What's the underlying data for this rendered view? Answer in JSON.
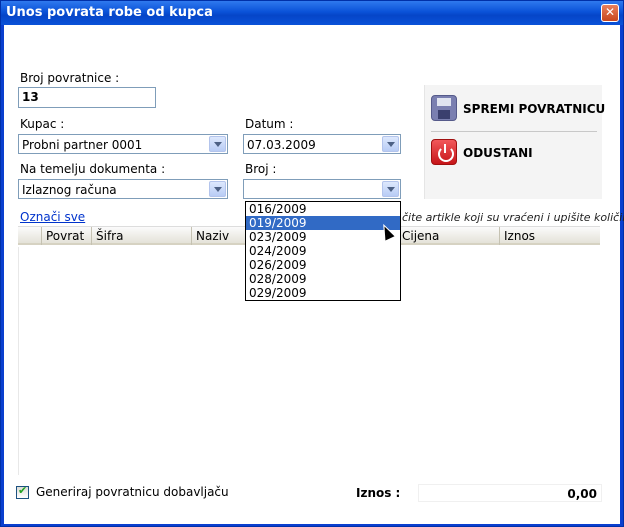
{
  "window": {
    "title": "Unos povrata robe od kupca",
    "close_glyph": "✕"
  },
  "form": {
    "broj_povratnice": {
      "label": "Broj povratnice :",
      "value": "13"
    },
    "kupac": {
      "label": "Kupac :",
      "value": "Probni partner 0001"
    },
    "datum": {
      "label": "Datum :",
      "value": "07.03.2009"
    },
    "na_temelju": {
      "label": "Na temelju dokumenta :",
      "value": "Izlaznog računa"
    },
    "broj": {
      "label": "Broj :",
      "value": ""
    }
  },
  "commands": {
    "save": {
      "label": "SPREMI POVRATNICU",
      "icon": "floppy-disk-icon"
    },
    "cancel": {
      "label": "ODUSTANI",
      "icon": "power-icon"
    }
  },
  "grid": {
    "select_all_link": "Označi sve",
    "hint": "čite artikle koji su vraćeni i upišite količine",
    "columns": [
      "Povrat",
      "Šifra",
      "Naziv",
      "Cijena",
      "Iznos"
    ]
  },
  "dropdown": {
    "items": [
      "016/2009",
      "019/2009",
      "023/2009",
      "024/2009",
      "026/2009",
      "028/2009",
      "029/2009"
    ],
    "selected": "019/2009"
  },
  "footer": {
    "checkbox_label": "Generiraj povratnicu dobavljaču",
    "checkbox_checked": true,
    "total_label": "Iznos :",
    "total_value": "0,00"
  },
  "colors": {
    "titlebar": "#0a52d8",
    "selection": "#316ac5",
    "link": "#0033cc"
  }
}
